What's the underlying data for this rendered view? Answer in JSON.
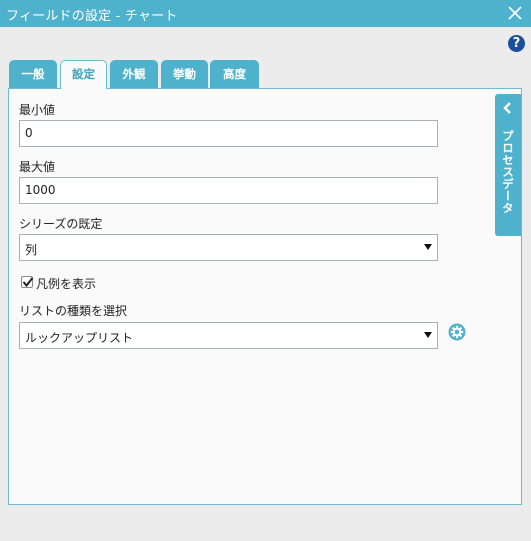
{
  "window": {
    "title": "フィールドの設定 - チャート",
    "close_icon": "close-icon",
    "help_label": "?",
    "help_icon": "help-icon"
  },
  "tabs": [
    {
      "label": "一般",
      "active": false
    },
    {
      "label": "設定",
      "active": true
    },
    {
      "label": "外観",
      "active": false
    },
    {
      "label": "挙動",
      "active": false
    },
    {
      "label": "高度",
      "active": false
    }
  ],
  "form": {
    "min_label": "最小値",
    "min_value": "0",
    "max_label": "最大値",
    "max_value": "1000",
    "series_label": "シリーズの既定",
    "series_value": "列",
    "legend_checkbox_label": "凡例を表示",
    "legend_checked": true,
    "list_type_label": "リストの種類を選択",
    "list_type_value": "ルックアップリスト"
  },
  "process_data_tab": {
    "label": "プロセスデータ",
    "icon": "chevron-left-icon"
  },
  "colors": {
    "accent": "#4fb2cc",
    "help": "#1d4f9c",
    "border": "#6dbdd2"
  }
}
